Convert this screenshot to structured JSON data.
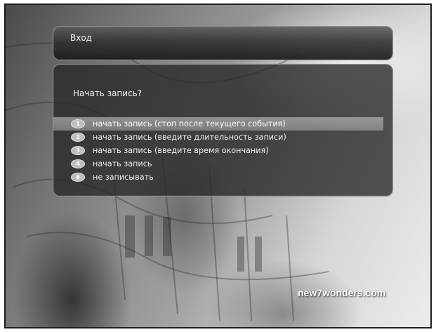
{
  "header": {
    "title": "Вход"
  },
  "dialog": {
    "question": "Начать запись?",
    "options": [
      {
        "number": "1",
        "label": "начать запись (стоп после текущего события)",
        "selected": true
      },
      {
        "number": "2",
        "label": "начать запись (введите длительность записи)",
        "selected": false
      },
      {
        "number": "3",
        "label": "начать запись (введите время окончания)",
        "selected": false
      },
      {
        "number": "4",
        "label": "начать запись",
        "selected": false
      },
      {
        "number": "6",
        "label": "не записывать",
        "selected": false
      }
    ]
  },
  "background": {
    "watermark": "new7wonders.com"
  },
  "colors": {
    "panel": "#262626",
    "highlight": "#c8c8c8",
    "text": "#f0f0f0"
  }
}
